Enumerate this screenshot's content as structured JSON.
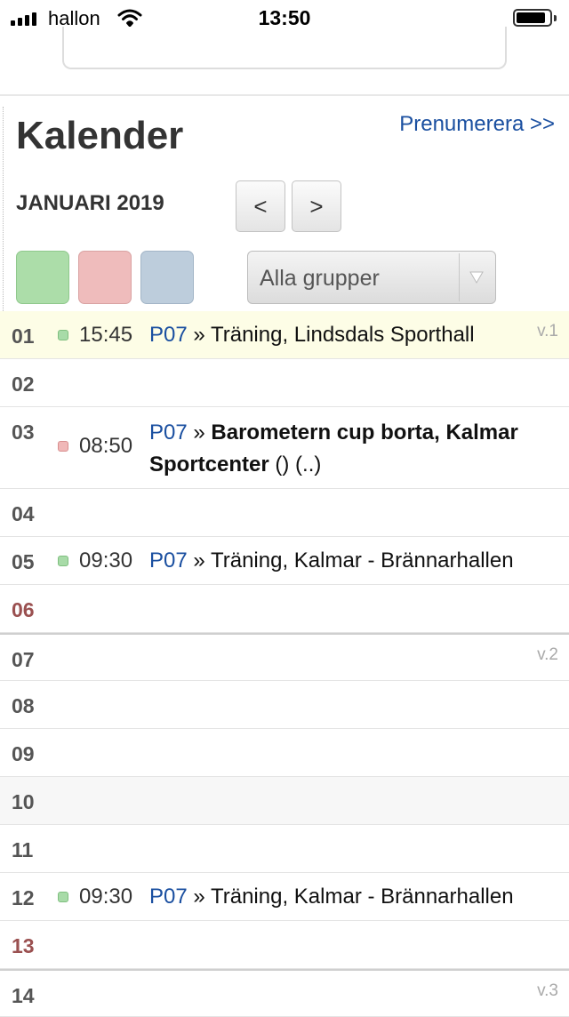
{
  "status_bar": {
    "carrier": "hallon",
    "time": "13:50"
  },
  "header": {
    "title": "Kalender",
    "subscribe_label": "Prenumerera >>",
    "month": "JANUARI 2019",
    "prev_label": "<",
    "next_label": ">"
  },
  "filters": {
    "color_boxes": [
      {
        "name": "green",
        "color": "#a8dba8"
      },
      {
        "name": "red",
        "color": "#f0b8b8"
      },
      {
        "name": "blue",
        "color": "#bccbdc"
      }
    ],
    "group_select": {
      "selected": "Alla grupper"
    }
  },
  "calendar": {
    "rows": [
      {
        "day": "01",
        "week": "v.1",
        "today": true,
        "event": {
          "color": "green",
          "time": "15:45",
          "group": "P07",
          "sep": "»",
          "text": "Träning, Lindsdals Sporthall"
        }
      },
      {
        "day": "02"
      },
      {
        "day": "03",
        "event": {
          "color": "red",
          "time": "08:50",
          "group": "P07",
          "sep": "»",
          "title_bold": "Barometern cup borta, Kalmar Sportcenter",
          "extra": "() (..)"
        }
      },
      {
        "day": "04"
      },
      {
        "day": "05",
        "event": {
          "color": "green",
          "time": "09:30",
          "group": "P07",
          "sep": "»",
          "text": "Träning, Kalmar - Brännarhallen"
        }
      },
      {
        "day": "06",
        "sunday": true
      },
      {
        "day": "07",
        "week": "v.2"
      },
      {
        "day": "08"
      },
      {
        "day": "09"
      },
      {
        "day": "10",
        "shaded": true
      },
      {
        "day": "11"
      },
      {
        "day": "12",
        "event": {
          "color": "green",
          "time": "09:30",
          "group": "P07",
          "sep": "»",
          "text": "Träning, Kalmar - Brännarhallen"
        }
      },
      {
        "day": "13",
        "sunday": true
      },
      {
        "day": "14",
        "week": "v.3"
      }
    ]
  }
}
